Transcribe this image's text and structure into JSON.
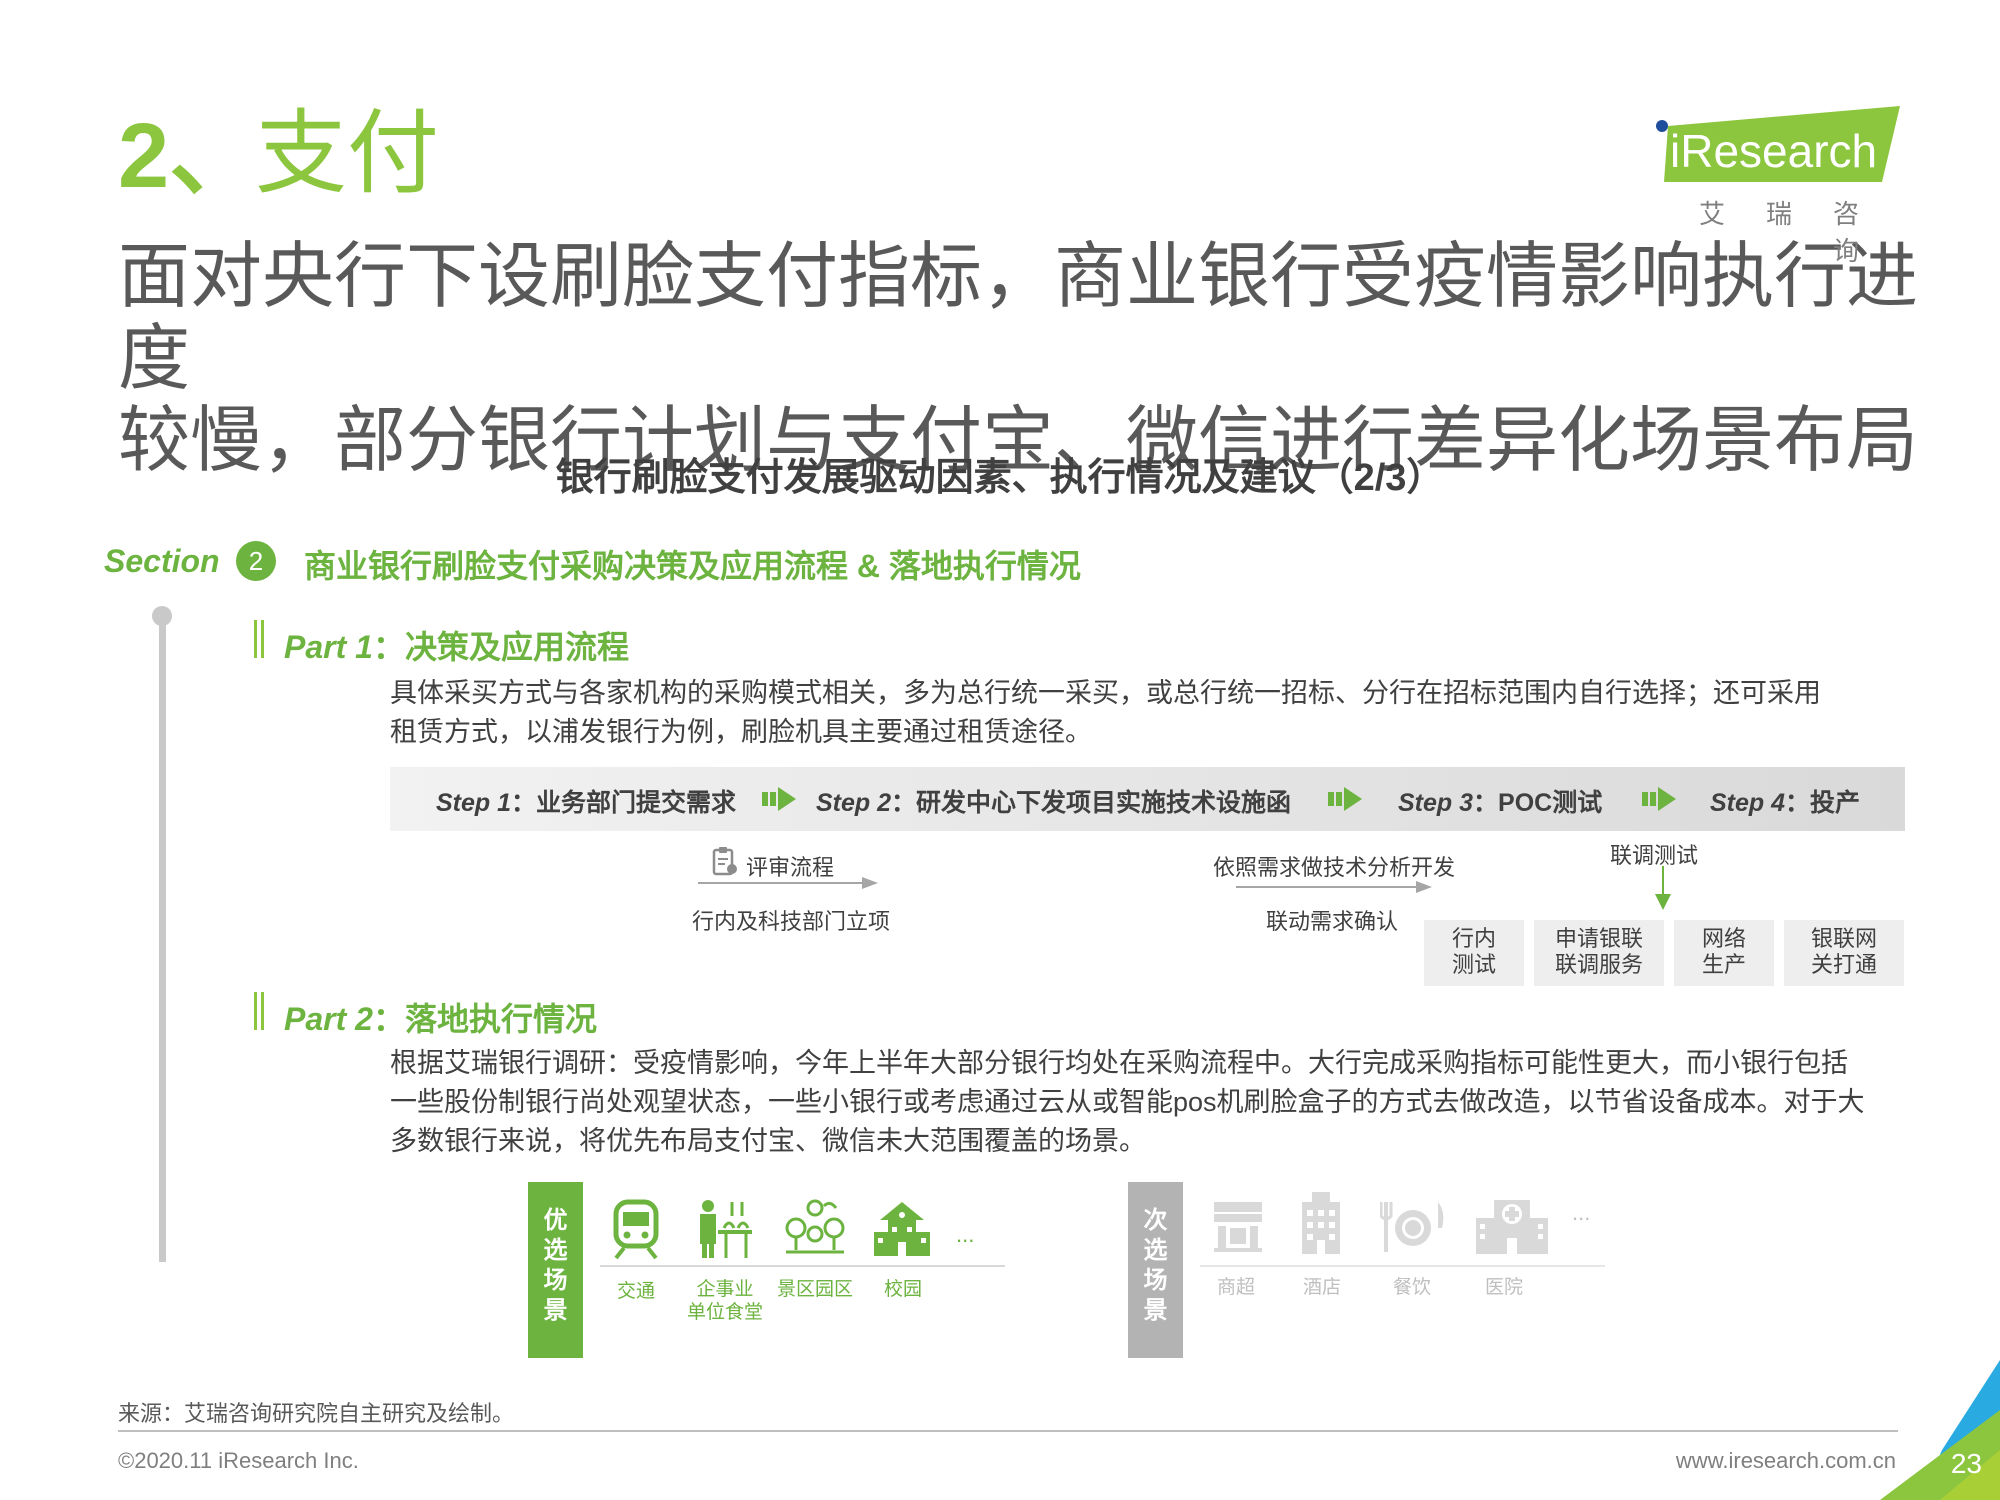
{
  "header": {
    "section_number": "2、",
    "section_title": "支付",
    "headline_line1": "面对央行下设刷脸支付指标，商业银行受疫情影响执行进度",
    "headline_line2": "较慢，部分银行计划与支付宝、微信进行差异化场景布局",
    "logo_text": "iResearch",
    "logo_subtitle": "艾瑞咨询"
  },
  "subhead": "银行刷脸支付发展驱动因素、执行情况及建议（2/3）",
  "section": {
    "label": "Section",
    "number": "2",
    "heading": "商业银行刷脸支付采购决策及应用流程 & 落地执行情况"
  },
  "part1": {
    "title_en": "Part 1",
    "title_cn": "：决策及应用流程",
    "text_line1": "具体采买方式与各家机构的采购模式相关，多为总行统一采买，或总行统一招标、分行在招标范围内自行选择；还可采用",
    "text_line2": "租赁方式，以浦发银行为例，刷脸机具主要通过租赁途径。",
    "steps": [
      {
        "en": "Step 1",
        "cn": "：业务部门提交需求"
      },
      {
        "en": "Step 2",
        "cn": "：研发中心下发项目实施技术设施函"
      },
      {
        "en": "Step 3",
        "cn": "：POC测试"
      },
      {
        "en": "Step 4",
        "cn": "：投产"
      }
    ],
    "review": "评审流程",
    "dept_project": "行内及科技部门立项",
    "tech_dev": "依照需求做技术分析开发",
    "joint_confirm": "联动需求确认",
    "joint_test": "联调测试",
    "boxes": [
      {
        "l1": "行内",
        "l2": "测试"
      },
      {
        "l1": "申请银联",
        "l2": "联调服务"
      },
      {
        "l1": "网络",
        "l2": "生产"
      },
      {
        "l1": "银联网",
        "l2": "关打通"
      }
    ]
  },
  "part2": {
    "title_en": "Part 2",
    "title_cn": "：落地执行情况",
    "text_line1": "根据艾瑞银行调研：受疫情影响，今年上半年大部分银行均处在采购流程中。大行完成采购指标可能性更大，而小银行包括",
    "text_line2": "一些股份制银行尚处观望状态，一些小银行或考虑通过云从或智能pos机刷脸盒子的方式去做改造，以节省设备成本。对于大",
    "text_line3": "多数银行来说，将优先布局支付宝、微信未大范围覆盖的场景。"
  },
  "scenes": {
    "preferred_tag": "优选场景",
    "preferred": [
      {
        "icon": "train-icon",
        "label": "交通"
      },
      {
        "icon": "canteen-icon",
        "label": "企事业单位食堂",
        "l1": "企事业",
        "l2": "单位食堂"
      },
      {
        "icon": "park-icon",
        "label": "景区园区"
      },
      {
        "icon": "school-icon",
        "label": "校园"
      }
    ],
    "secondary_tag": "次选场景",
    "secondary": [
      {
        "icon": "supermarket-icon",
        "label": "商超"
      },
      {
        "icon": "hotel-icon",
        "label": "酒店"
      },
      {
        "icon": "dining-icon",
        "label": "餐饮"
      },
      {
        "icon": "hospital-icon",
        "label": "医院"
      }
    ],
    "ellipsis": "..."
  },
  "footer": {
    "source": "来源：艾瑞咨询研究院自主研究及绘制。",
    "copyright": "©2020.11 iResearch Inc.",
    "website": "www.iresearch.com.cn",
    "page_number": "23"
  },
  "colors": {
    "brand_green": "#8cc63f",
    "text_green": "#6cb33f",
    "gray_tag": "#b3b3b3",
    "corner_blue": "#29abe2"
  }
}
